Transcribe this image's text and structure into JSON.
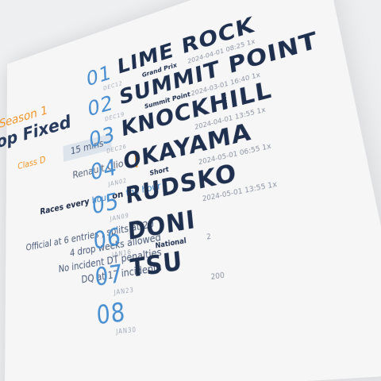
{
  "season": "Season 1",
  "title": "op Fixed",
  "class_label": "Class D",
  "duration": "15 mins",
  "car": "Renault Clio",
  "races": {
    "prefix": "Races every",
    "unit": "hour",
    "middle": "on",
    "suffix": "the hour"
  },
  "rules": [
    "Official at 6 entries , splits at 20",
    "4 drop weeks allowed",
    "No incident DT penalties",
    "DQ at 17 incidents"
  ],
  "rounds": [
    {
      "num": "01",
      "track": "LIME ROCK",
      "date": "DEC12",
      "layout": "Grand Prix",
      "start": "2024-04-01 08:25 1x"
    },
    {
      "num": "02",
      "track": "SUMMIT POINT",
      "date": "DEC19",
      "layout": "Summit Point",
      "start": "2024-03-01 16:40 1x"
    },
    {
      "num": "03",
      "track": "KNOCKHILL",
      "date": "DEC26",
      "layout": "",
      "start": "2024-04-01 13:55 1x"
    },
    {
      "num": "04",
      "track": "OKAYAMA",
      "date": "JAN02",
      "layout": "Short",
      "start": "2024-05-01 06:55 1x"
    },
    {
      "num": "05",
      "track": "RUDSKO",
      "date": "JAN09",
      "layout": "",
      "start": "2024-05-01 13:55 1x"
    },
    {
      "num": "06",
      "track": "DONI",
      "date": "JAN16",
      "layout": "National",
      "start": "2"
    },
    {
      "num": "07",
      "track": "TSU",
      "date": "JAN23",
      "layout": "",
      "start": "200"
    },
    {
      "num": "08",
      "track": "",
      "date": "JAN30",
      "layout": "",
      "start": ""
    }
  ]
}
